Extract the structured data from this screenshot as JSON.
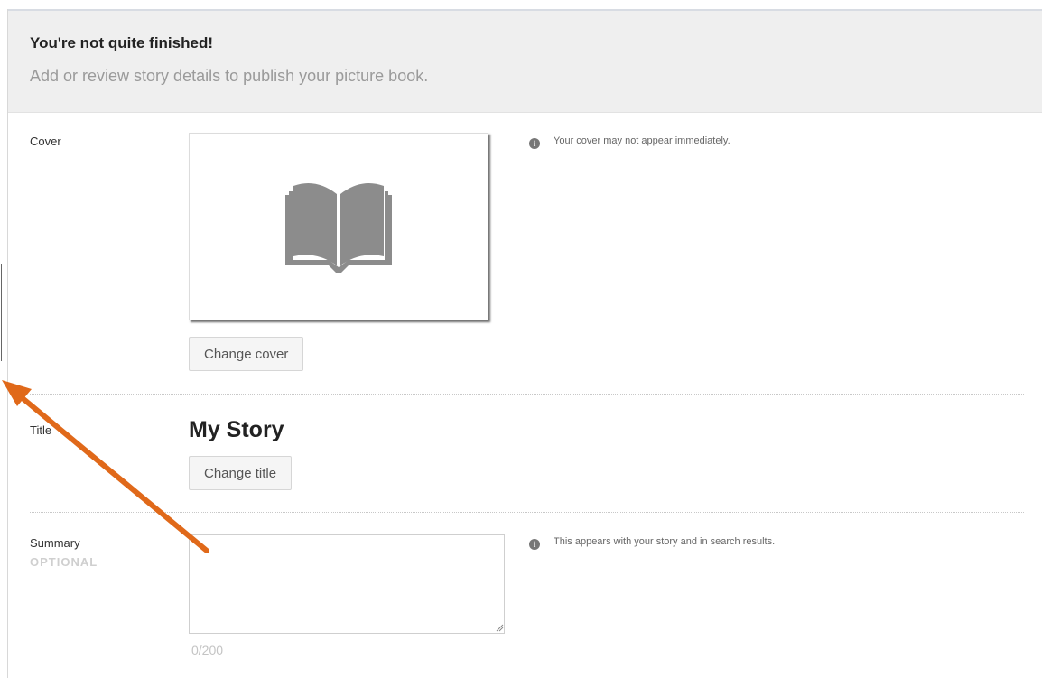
{
  "header": {
    "title": "You're not quite finished!",
    "subtitle": "Add or review story details to publish your picture book."
  },
  "cover": {
    "label": "Cover",
    "change_button": "Change cover",
    "info": "Your cover may not appear immediately.",
    "icon": "open-book-icon"
  },
  "title_section": {
    "label": "Title",
    "value": "My Story",
    "change_button": "Change title"
  },
  "summary": {
    "label": "Summary",
    "optional_label": "OPTIONAL",
    "value": "",
    "info": "This appears with your story and in search results.",
    "char_count": "0/200"
  },
  "colors": {
    "annotation_arrow": "#e0691a",
    "banner_bg": "#efefef",
    "icon_gray": "#8c8c8c"
  }
}
